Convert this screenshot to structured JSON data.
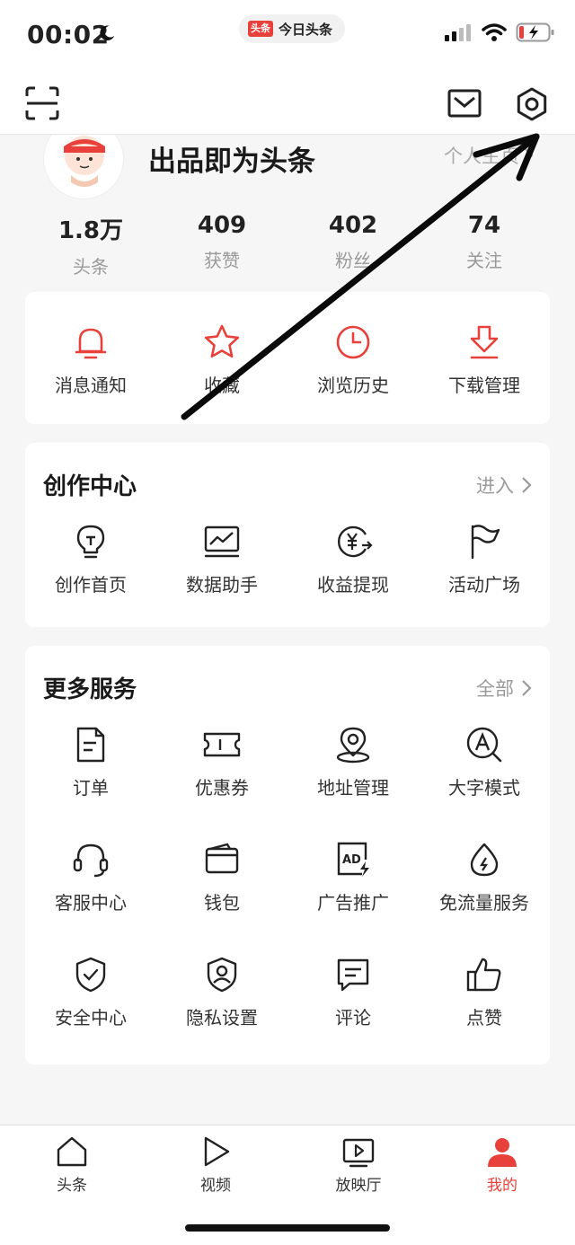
{
  "status_bar": {
    "time": "00:02",
    "app_logo": "头条",
    "app_name": "今日头条"
  },
  "profile": {
    "username": "出品即为头条",
    "homepage_link": "个人主页",
    "stats": [
      {
        "value": "1.8万",
        "label": "头条"
      },
      {
        "value": "409",
        "label": "获赞"
      },
      {
        "value": "402",
        "label": "粉丝"
      },
      {
        "value": "74",
        "label": "关注"
      }
    ]
  },
  "quick_actions": [
    {
      "label": "消息通知",
      "icon": "bell-icon"
    },
    {
      "label": "收藏",
      "icon": "star-icon"
    },
    {
      "label": "浏览历史",
      "icon": "clock-icon"
    },
    {
      "label": "下载管理",
      "icon": "download-icon"
    }
  ],
  "creation": {
    "title": "创作中心",
    "more": "进入",
    "items": [
      {
        "label": "创作首页",
        "icon": "lightbulb-icon"
      },
      {
        "label": "数据助手",
        "icon": "chart-icon"
      },
      {
        "label": "收益提现",
        "icon": "yuan-icon"
      },
      {
        "label": "活动广场",
        "icon": "flag-icon"
      }
    ]
  },
  "services": {
    "title": "更多服务",
    "more": "全部",
    "items": [
      {
        "label": "订单",
        "icon": "order-icon"
      },
      {
        "label": "优惠券",
        "icon": "coupon-icon"
      },
      {
        "label": "地址管理",
        "icon": "location-icon"
      },
      {
        "label": "大字模式",
        "icon": "font-size-icon"
      },
      {
        "label": "客服中心",
        "icon": "headset-icon"
      },
      {
        "label": "钱包",
        "icon": "wallet-icon"
      },
      {
        "label": "广告推广",
        "icon": "ad-icon"
      },
      {
        "label": "免流量服务",
        "icon": "data-drop-icon"
      },
      {
        "label": "安全中心",
        "icon": "shield-icon"
      },
      {
        "label": "隐私设置",
        "icon": "privacy-icon"
      },
      {
        "label": "评论",
        "icon": "comment-icon"
      },
      {
        "label": "点赞",
        "icon": "thumbs-up-icon"
      }
    ]
  },
  "bottom_nav": [
    {
      "label": "头条",
      "icon": "home-icon",
      "active": false
    },
    {
      "label": "视频",
      "icon": "play-icon",
      "active": false
    },
    {
      "label": "放映厅",
      "icon": "tv-icon",
      "active": false
    },
    {
      "label": "我的",
      "icon": "person-icon",
      "active": true
    }
  ],
  "colors": {
    "accent": "#e8413c",
    "background": "#f6f6f6",
    "card": "#ffffff",
    "muted_text": "#9a9a9a"
  }
}
